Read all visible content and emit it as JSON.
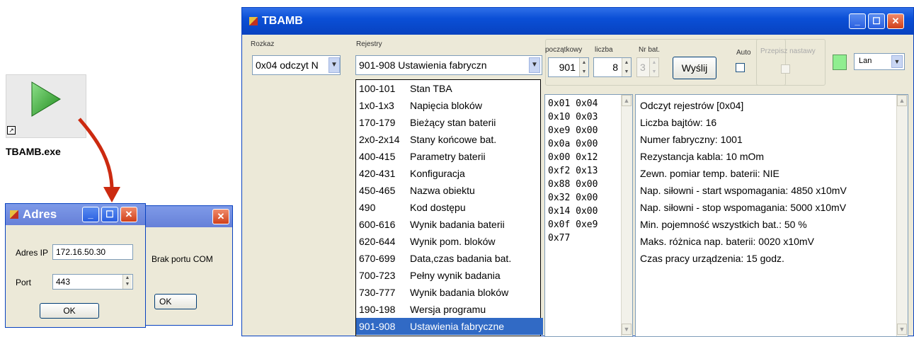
{
  "desktop": {
    "icon_label": "TBAMB.exe"
  },
  "main_window": {
    "title": "TBAMB",
    "rozkaz": {
      "label": "Rozkaz",
      "value": "0x04 odczyt N"
    },
    "rejestry": {
      "label": "Rejestry",
      "value": "901-908  Ustawienia fabryczn"
    },
    "poczatkowy": {
      "label": "początkowy",
      "value": "901"
    },
    "liczba": {
      "label": "liczba",
      "value": "8"
    },
    "nr_bat": {
      "label": "Nr bat.",
      "value": "3"
    },
    "send_label": "Wyślij",
    "auto_label": "Auto",
    "przepisz_label": "Przepisz nastawy",
    "connection": {
      "value": "Lan"
    },
    "status_color": "#90ee90"
  },
  "register_list": [
    {
      "range": "100-101",
      "name": "Stan TBA"
    },
    {
      "range": "1x0-1x3",
      "name": "Napięcia bloków"
    },
    {
      "range": "170-179",
      "name": "Bieżący stan baterii"
    },
    {
      "range": "2x0-2x14",
      "name": "Stany końcowe bat."
    },
    {
      "range": "400-415",
      "name": "Parametry baterii"
    },
    {
      "range": "420-431",
      "name": "Konfiguracja"
    },
    {
      "range": "450-465",
      "name": "Nazwa obiektu"
    },
    {
      "range": "490",
      "name": "Kod dostępu"
    },
    {
      "range": "600-616",
      "name": "Wynik badania baterii"
    },
    {
      "range": "620-644",
      "name": "Wynik pom. bloków"
    },
    {
      "range": "670-699",
      "name": "Data,czas badania bat."
    },
    {
      "range": "700-723",
      "name": "Pełny wynik badania"
    },
    {
      "range": "730-777",
      "name": "Wynik badania bloków"
    },
    {
      "range": "190-198",
      "name": "Wersja programu"
    },
    {
      "range": "901-908",
      "name": "Ustawienia fabryczne"
    }
  ],
  "hex_lines": [
    "0x01 0x04",
    "0x10 0x03",
    "0xe9 0x00",
    "0x0a 0x00",
    "0x00 0x12",
    "0xf2 0x13",
    "0x88 0x00",
    "0x32 0x00",
    "0x14 0x00",
    "0x0f 0xe9",
    "0x77"
  ],
  "result_lines": [
    "Odczyt rejestrów [0x04]",
    "Liczba bajtów: 16",
    "Numer fabryczny: 1001",
    "Rezystancja kabla: 10 mOm",
    "Zewn. pomiar temp. baterii: NIE",
    "Nap. siłowni - start wspomagania: 4850 x10mV",
    "Nap. siłowni - stop wspomagania: 5000 x10mV",
    "Min. pojemność wszystkich bat.: 50 %",
    "Maks. różnica nap. baterii: 0020 x10mV",
    "Czas pracy urządzenia: 15 godz."
  ],
  "adres_dialog": {
    "title": "Adres",
    "ip_label": "Adres IP",
    "ip_value": "172.16.50.30",
    "port_label": "Port",
    "port_value": "443",
    "ok_label": "OK"
  },
  "com_dialog": {
    "message": "Brak portu COM",
    "ok_label": "OK"
  }
}
